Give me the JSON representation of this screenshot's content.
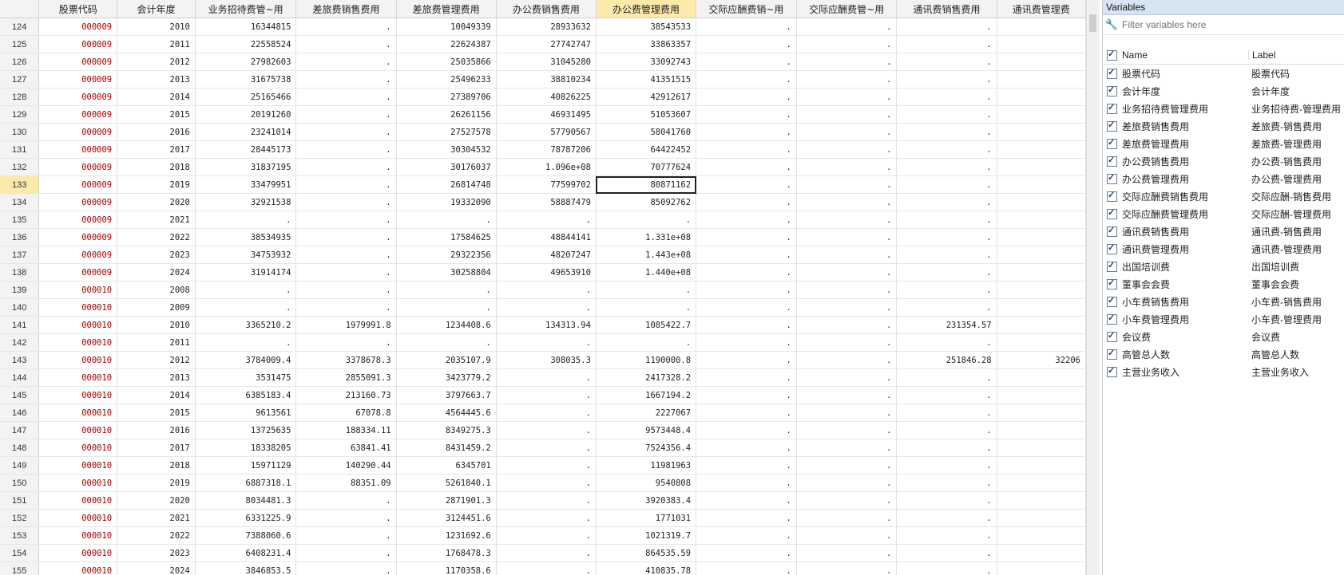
{
  "grid": {
    "columns": [
      "股票代码",
      "会计年度",
      "业务招待费管~用",
      "差旅费销售费用",
      "差旅费管理费用",
      "办公费销售费用",
      "办公费管理费用",
      "交际应酬费销~用",
      "交际应酬费管~用",
      "通讯费销售费用",
      "通讯费管理费"
    ],
    "selected_column_index": 6,
    "selected_row": "133",
    "rows": [
      [
        "124",
        "000009",
        "2010",
        "16344815",
        ".",
        "10049339",
        "28933632",
        "38543533",
        ".",
        ".",
        ".",
        ""
      ],
      [
        "125",
        "000009",
        "2011",
        "22558524",
        ".",
        "22624387",
        "27742747",
        "33863357",
        ".",
        ".",
        ".",
        ""
      ],
      [
        "126",
        "000009",
        "2012",
        "27982603",
        ".",
        "25035866",
        "31045280",
        "33092743",
        ".",
        ".",
        ".",
        ""
      ],
      [
        "127",
        "000009",
        "2013",
        "31675738",
        ".",
        "25496233",
        "38810234",
        "41351515",
        ".",
        ".",
        ".",
        ""
      ],
      [
        "128",
        "000009",
        "2014",
        "25165466",
        ".",
        "27389706",
        "40826225",
        "42912617",
        ".",
        ".",
        ".",
        ""
      ],
      [
        "129",
        "000009",
        "2015",
        "20191260",
        ".",
        "26261156",
        "46931495",
        "51053607",
        ".",
        ".",
        ".",
        ""
      ],
      [
        "130",
        "000009",
        "2016",
        "23241014",
        ".",
        "27527578",
        "57790567",
        "58041760",
        ".",
        ".",
        ".",
        ""
      ],
      [
        "131",
        "000009",
        "2017",
        "28445173",
        ".",
        "30304532",
        "78787206",
        "64422452",
        ".",
        ".",
        ".",
        ""
      ],
      [
        "132",
        "000009",
        "2018",
        "31837195",
        ".",
        "30176037",
        "1.096e+08",
        "70777624",
        ".",
        ".",
        ".",
        ""
      ],
      [
        "133",
        "000009",
        "2019",
        "33479951",
        ".",
        "26814748",
        "77599702",
        "80871162",
        ".",
        ".",
        ".",
        ""
      ],
      [
        "134",
        "000009",
        "2020",
        "32921538",
        ".",
        "19332090",
        "58887479",
        "85092762",
        ".",
        ".",
        ".",
        ""
      ],
      [
        "135",
        "000009",
        "2021",
        ".",
        ".",
        ".",
        ".",
        ".",
        ".",
        ".",
        ".",
        ""
      ],
      [
        "136",
        "000009",
        "2022",
        "38534935",
        ".",
        "17584625",
        "48844141",
        "1.331e+08",
        ".",
        ".",
        ".",
        ""
      ],
      [
        "137",
        "000009",
        "2023",
        "34753932",
        ".",
        "29322356",
        "48207247",
        "1.443e+08",
        ".",
        ".",
        ".",
        ""
      ],
      [
        "138",
        "000009",
        "2024",
        "31914174",
        ".",
        "30258804",
        "49653910",
        "1.440e+08",
        ".",
        ".",
        ".",
        ""
      ],
      [
        "139",
        "000010",
        "2008",
        ".",
        ".",
        ".",
        ".",
        ".",
        ".",
        ".",
        ".",
        ""
      ],
      [
        "140",
        "000010",
        "2009",
        ".",
        ".",
        ".",
        ".",
        ".",
        ".",
        ".",
        ".",
        ""
      ],
      [
        "141",
        "000010",
        "2010",
        "3365210.2",
        "1979991.8",
        "1234408.6",
        "134313.94",
        "1085422.7",
        ".",
        ".",
        "231354.57",
        ""
      ],
      [
        "142",
        "000010",
        "2011",
        ".",
        ".",
        ".",
        ".",
        ".",
        ".",
        ".",
        ".",
        ""
      ],
      [
        "143",
        "000010",
        "2012",
        "3784009.4",
        "3378678.3",
        "2035107.9",
        "308035.3",
        "1190000.8",
        ".",
        ".",
        "251846.28",
        "32206"
      ],
      [
        "144",
        "000010",
        "2013",
        "3531475",
        "2855091.3",
        "3423779.2",
        ".",
        "2417328.2",
        ".",
        ".",
        ".",
        ""
      ],
      [
        "145",
        "000010",
        "2014",
        "6385183.4",
        "213160.73",
        "3797663.7",
        ".",
        "1667194.2",
        ".",
        ".",
        ".",
        ""
      ],
      [
        "146",
        "000010",
        "2015",
        "9613561",
        "67078.8",
        "4564445.6",
        ".",
        "2227067",
        ".",
        ".",
        ".",
        ""
      ],
      [
        "147",
        "000010",
        "2016",
        "13725635",
        "188334.11",
        "8349275.3",
        ".",
        "9573448.4",
        ".",
        ".",
        ".",
        ""
      ],
      [
        "148",
        "000010",
        "2017",
        "18338205",
        "63841.41",
        "8431459.2",
        ".",
        "7524356.4",
        ".",
        ".",
        ".",
        ""
      ],
      [
        "149",
        "000010",
        "2018",
        "15971129",
        "140290.44",
        "6345701",
        ".",
        "11981963",
        ".",
        ".",
        ".",
        ""
      ],
      [
        "150",
        "000010",
        "2019",
        "6887318.1",
        "88351.09",
        "5261840.1",
        ".",
        "9540808",
        ".",
        ".",
        ".",
        ""
      ],
      [
        "151",
        "000010",
        "2020",
        "8034481.3",
        ".",
        "2871901.3",
        ".",
        "3920383.4",
        ".",
        ".",
        ".",
        ""
      ],
      [
        "152",
        "000010",
        "2021",
        "6331225.9",
        ".",
        "3124451.6",
        ".",
        "1771031",
        ".",
        ".",
        ".",
        ""
      ],
      [
        "153",
        "000010",
        "2022",
        "7388060.6",
        ".",
        "1231692.6",
        ".",
        "1021319.7",
        ".",
        ".",
        ".",
        ""
      ],
      [
        "154",
        "000010",
        "2023",
        "6408231.4",
        ".",
        "1768478.3",
        ".",
        "864535.59",
        ".",
        ".",
        ".",
        ""
      ],
      [
        "155",
        "000010",
        "2024",
        "3846853.5",
        ".",
        "1170358.6",
        ".",
        "410835.78",
        ".",
        ".",
        ".",
        ""
      ]
    ]
  },
  "variables_panel": {
    "title": "Variables",
    "filter_placeholder": "Filter variables here",
    "header_name": "Name",
    "header_label": "Label",
    "items": [
      {
        "name": "股票代码",
        "label": "股票代码"
      },
      {
        "name": "会计年度",
        "label": "会计年度"
      },
      {
        "name": "业务招待费管理费用",
        "label": "业务招待费-管理费用"
      },
      {
        "name": "差旅费销售费用",
        "label": "差旅费-销售费用"
      },
      {
        "name": "差旅费管理费用",
        "label": "差旅费-管理费用"
      },
      {
        "name": "办公费销售费用",
        "label": "办公费-销售费用"
      },
      {
        "name": "办公费管理费用",
        "label": "办公费-管理费用"
      },
      {
        "name": "交际应酬费销售费用",
        "label": "交际应酬-销售费用"
      },
      {
        "name": "交际应酬费管理费用",
        "label": "交际应酬-管理费用"
      },
      {
        "name": "通讯费销售费用",
        "label": "通讯费-销售费用"
      },
      {
        "name": "通讯费管理费用",
        "label": "通讯费-管理费用"
      },
      {
        "name": "出国培训费",
        "label": "出国培训费"
      },
      {
        "name": "董事会会费",
        "label": "董事会会费"
      },
      {
        "name": "小车费销售费用",
        "label": "小车费-销售费用"
      },
      {
        "name": "小车费管理费用",
        "label": "小车费-管理费用"
      },
      {
        "name": "会议费",
        "label": "会议费"
      },
      {
        "name": "高管总人数",
        "label": "高管总人数"
      },
      {
        "name": "主营业务收入",
        "label": "主营业务收入"
      }
    ]
  },
  "colors": {
    "code_text": "#a40000",
    "selected_header": "#fde9a9",
    "panel_title_bg": "#d7e4f2"
  },
  "icons": {
    "filter": "wrench-icon",
    "check": "checkbox-checked-icon"
  }
}
